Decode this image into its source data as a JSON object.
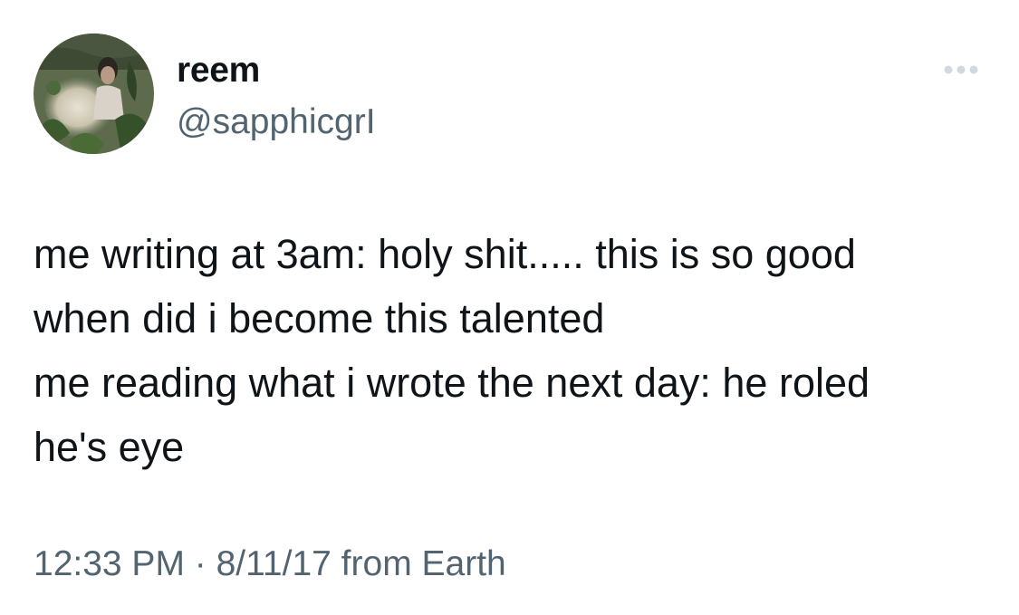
{
  "user": {
    "display_name": "reem",
    "handle": "@sapphicgrI",
    "avatar": "profile-photo"
  },
  "more_icon": "more-horizontal-icon",
  "tweet": {
    "lines": [
      "me writing at 3am: holy shit..... this is so good",
      "when did i become this talented",
      "me reading what i wrote the next day: he roled",
      "he's eye"
    ]
  },
  "meta": {
    "time": "12:33 PM",
    "separator": " · ",
    "date": "8/11/17",
    "source": " from Earth"
  },
  "colors": {
    "text": "#0f1419",
    "secondary": "#536471",
    "background": "#ffffff"
  }
}
